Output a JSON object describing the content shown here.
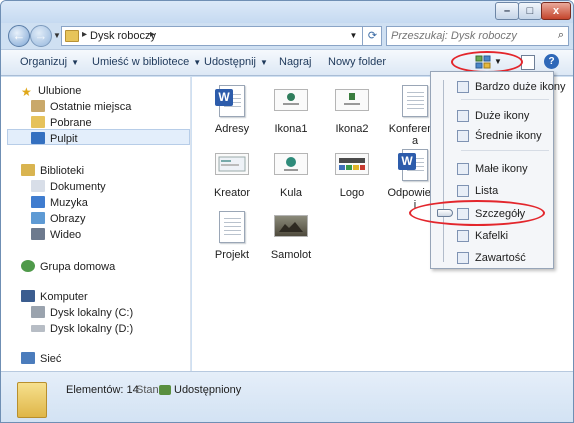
{
  "window": {
    "caption_buttons": {
      "minimize": "–",
      "maximize": "□",
      "close": "x"
    }
  },
  "address": {
    "crumb": "Dysk roboczy",
    "search_placeholder": "Przeszukaj: Dysk roboczy"
  },
  "toolbar": {
    "organize": "Organizuj",
    "include_library": "Umieść w bibliotece",
    "share": "Udostępnij",
    "burn": "Nagraj",
    "new_folder": "Nowy folder",
    "help": "?"
  },
  "sidebar": {
    "favorites_header": "Ulubione",
    "favorites": [
      "Ostatnie miejsca",
      "Pobrane",
      "Pulpit"
    ],
    "libraries_header": "Biblioteki",
    "libraries": [
      "Dokumenty",
      "Muzyka",
      "Obrazy",
      "Wideo"
    ],
    "homegroup": "Grupa domowa",
    "computer_header": "Komputer",
    "drives": [
      "Dysk lokalny (C:)",
      "Dysk lokalny (D:)"
    ],
    "network": "Sieć"
  },
  "files": [
    {
      "name": "Adresy",
      "icon": "word-doc-icon"
    },
    {
      "name": "Ikona1",
      "icon": "image-thumb-icon"
    },
    {
      "name": "Ikona2",
      "icon": "image-thumb-icon"
    },
    {
      "name": "Konferencj",
      "name2": "a",
      "icon": "text-doc-icon"
    },
    {
      "name": "Kreator",
      "icon": "image-thumb-icon"
    },
    {
      "name": "Kula",
      "icon": "image-thumb-icon"
    },
    {
      "name": "Logo",
      "icon": "image-thumb-icon"
    },
    {
      "name": "Odpowiedz",
      "name2": "i",
      "icon": "word-doc-icon"
    },
    {
      "name": "Projekt",
      "icon": "text-doc-icon"
    },
    {
      "name": "Samolot",
      "icon": "photo-thumb-icon"
    }
  ],
  "view_menu": {
    "items": [
      "Bardzo duże ikony",
      "Duże ikony",
      "Średnie ikony",
      "Małe ikony",
      "Lista",
      "Szczegóły",
      "Kafelki",
      "Zawartość"
    ],
    "underlined_letters": [
      "Ż",
      "D",
      "Ś",
      "M",
      "L",
      "S",
      "K",
      "Z"
    ],
    "selected": "Szczegóły"
  },
  "status": {
    "count": "Elementów: 14",
    "state_label": "Stan:",
    "state_value": "Udostępniony"
  },
  "colors": {
    "annotation_red": "#e3262c",
    "accent_blue": "#2f68b8"
  }
}
